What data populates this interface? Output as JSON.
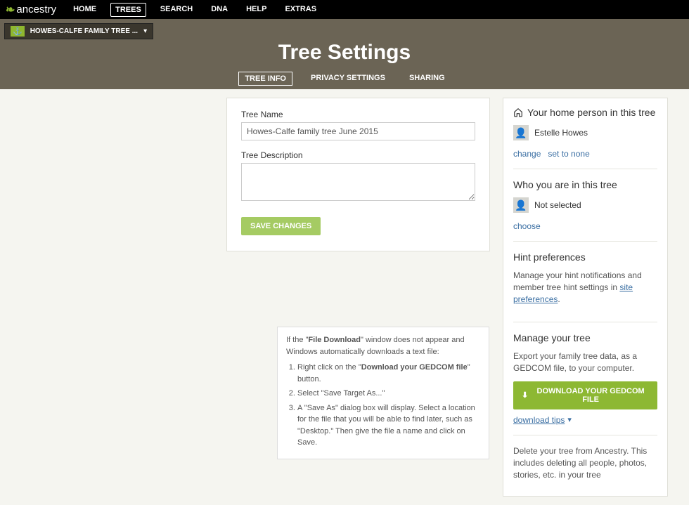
{
  "brand": "ancestry",
  "nav": {
    "home": "HOME",
    "trees": "TREES",
    "search": "SEARCH",
    "dna": "DNA",
    "help": "HELP",
    "extras": "EXTRAS"
  },
  "tree_selector": {
    "label": "HOWES-CALFE FAMILY TREE ..."
  },
  "page_title": "Tree Settings",
  "tabs": {
    "info": "TREE INFO",
    "privacy": "PRIVACY SETTINGS",
    "sharing": "SHARING"
  },
  "form": {
    "tree_name_label": "Tree Name",
    "tree_name_value": "Howes-Calfe family tree June 2015",
    "tree_desc_label": "Tree Description",
    "save_label": "SAVE CHANGES"
  },
  "sidebar": {
    "home_person": {
      "heading": "Your home person in this tree",
      "name": "Estelle Howes",
      "change": "change",
      "set_none": "set to none"
    },
    "who_you_are": {
      "heading": "Who you are in this tree",
      "value": "Not selected",
      "choose": "choose"
    },
    "hints": {
      "heading": "Hint preferences",
      "text_before": "Manage your hint notifications and member tree hint settings in ",
      "link": "site preferences",
      "after": "."
    },
    "manage": {
      "heading": "Manage your tree",
      "text": "Export your family tree data, as a GEDCOM file, to your computer.",
      "button": "DOWNLOAD YOUR GEDCOM FILE",
      "tips": "download tips"
    },
    "delete": {
      "text": "Delete your tree from Ancestry. This includes deleting all people, photos, stories, etc. in your tree"
    }
  },
  "infobox": {
    "intro_before": "If the \"",
    "intro_bold1": "File Download",
    "intro_mid": "\" window does not appear and Windows automatically downloads a text file:",
    "step1_before": "Right click on the \"",
    "step1_bold": "Download your GEDCOM file",
    "step1_after": "\" button.",
    "step2": "Select \"Save Target As...\"",
    "step3": "A \"Save As\" dialog box will display. Select a location for the file that you will be able to find later, such as \"Desktop.\" Then give the file a name and click on Save."
  }
}
